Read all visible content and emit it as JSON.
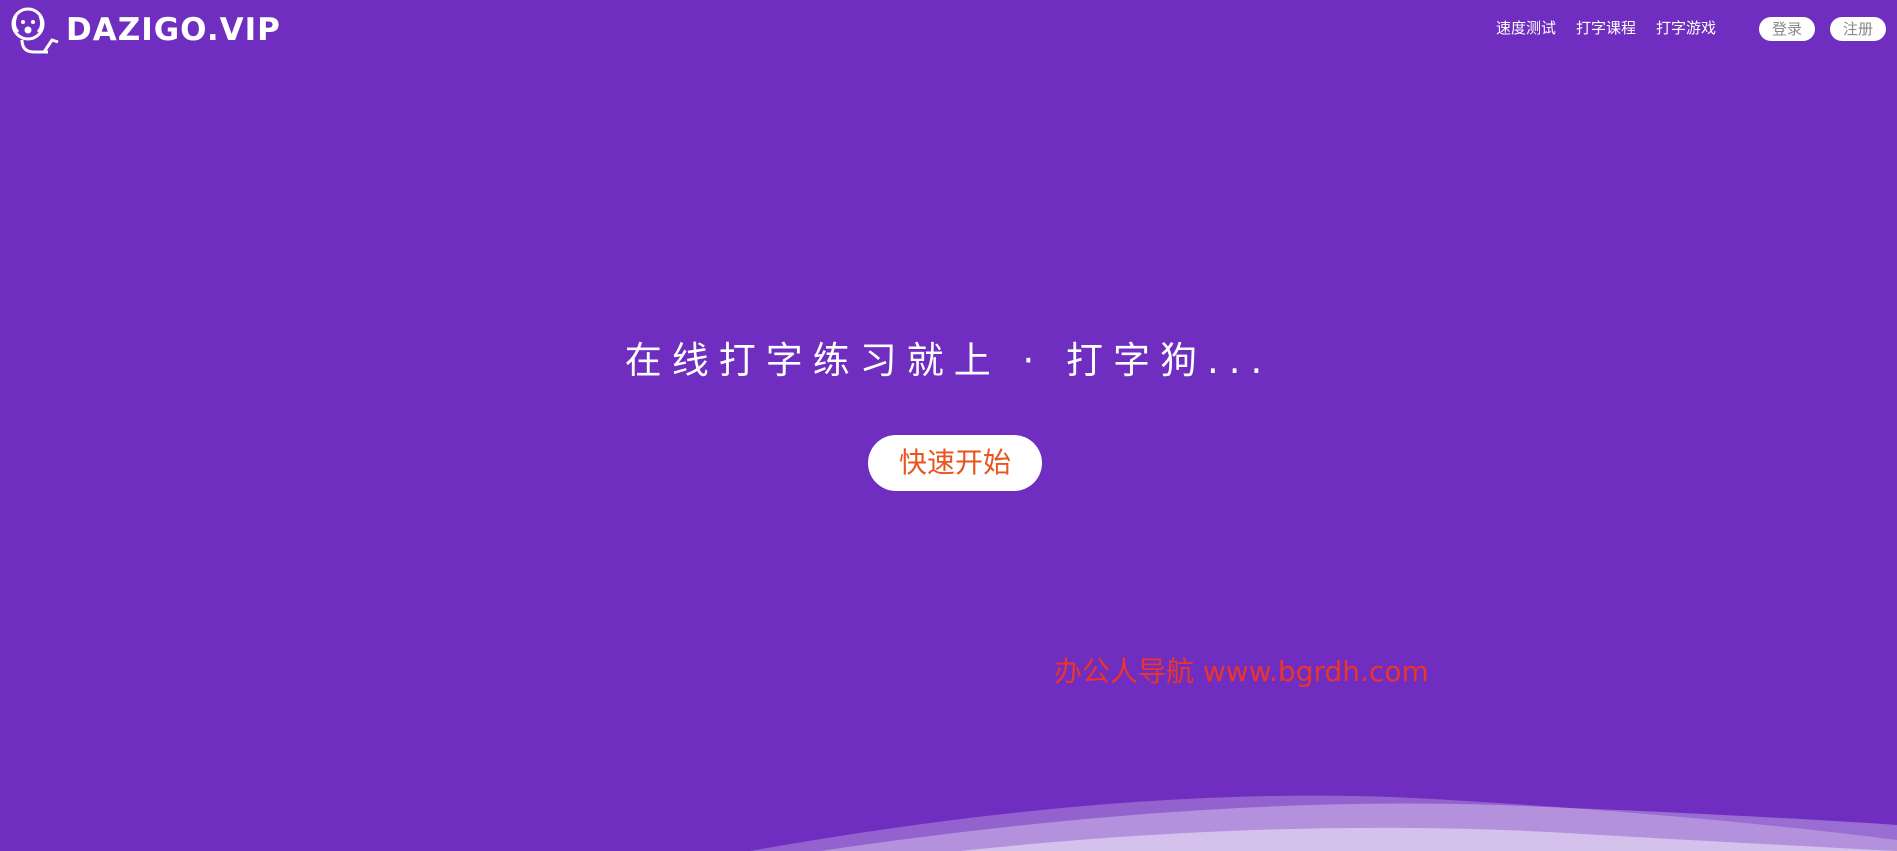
{
  "brand": {
    "name": "DAZIGO.VIP"
  },
  "nav": {
    "items": [
      {
        "label": "速度测试"
      },
      {
        "label": "打字课程"
      },
      {
        "label": "打字游戏"
      }
    ],
    "login_label": "登录",
    "register_label": "注册"
  },
  "hero": {
    "title": "在线打字练习就上 · 打字狗...",
    "start_label": "快速开始"
  },
  "watermark": {
    "text": "办公人导航 www.bgrdh.com"
  },
  "colors": {
    "background": "#6f2ebf",
    "start_text": "#e8561e",
    "watermark": "#e9352e"
  }
}
